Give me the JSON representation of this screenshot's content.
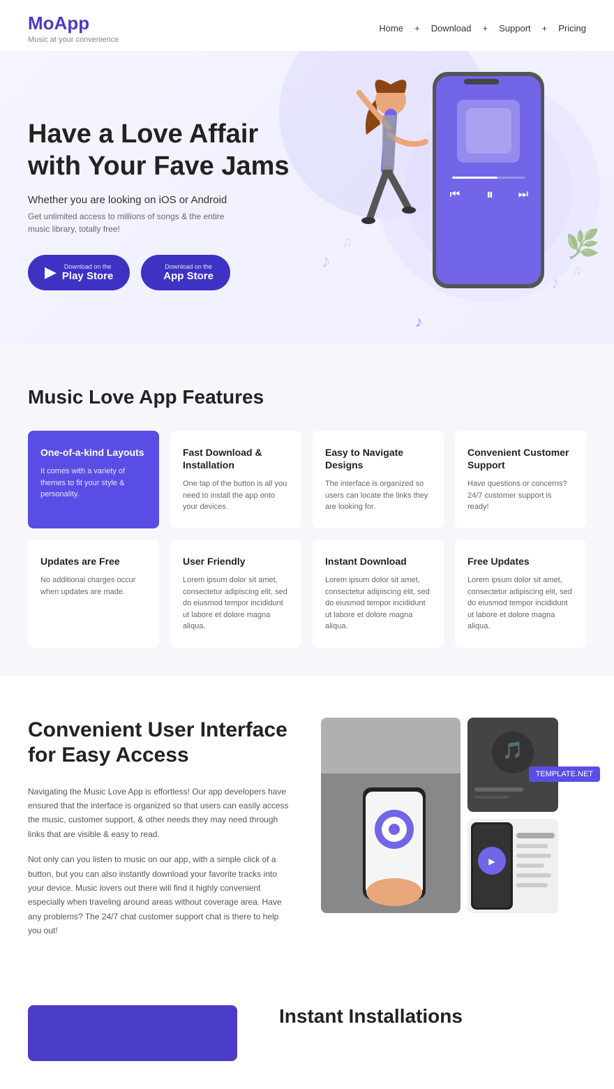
{
  "nav": {
    "logo": "MoApp",
    "tagline": "Music at your convenience",
    "links": [
      "Home",
      "Download",
      "Support",
      "Pricing"
    ],
    "separator": "+"
  },
  "hero": {
    "title_line1": "Have a Love Affair",
    "title_line2": "with Your Fave Jams",
    "subtitle": "Whether you are looking on iOS or Android",
    "desc": "Get unlimited access to millions of songs & the entire\nmusic library, totally free!",
    "btn1_top": "Download on the",
    "btn1_main": "Play Store",
    "btn2_top": "Download on the",
    "btn2_main": "App Store"
  },
  "features": {
    "section_title": "Music Love App Features",
    "row1": [
      {
        "title": "One-of-a-kind Layouts",
        "desc": "It comes with a variety of themes to fit your style & personality.",
        "highlight": true
      },
      {
        "title": "Fast Download & Installation",
        "desc": "One tap of the button is all you need to install the app onto your devices.",
        "highlight": false
      },
      {
        "title": "Easy to Navigate Designs",
        "desc": "The interface is organized so users can locate the links they are looking for.",
        "highlight": false
      },
      {
        "title": "Convenient Customer Support",
        "desc": "Have questions or concerns? 24/7 customer support is ready!",
        "highlight": false
      }
    ],
    "row2": [
      {
        "title": "Updates are Free",
        "desc": "No additional charges occur when updates are made.",
        "highlight": false
      },
      {
        "title": "User Friendly",
        "desc": "Lorem ipsum dolor sit amet, consectetur adipiscing elit, sed do eiusmod tempor incididunt ut labore et dolore magna aliqua.",
        "highlight": false
      },
      {
        "title": "Instant Download",
        "desc": "Lorem ipsum dolor sit amet, consectetur adipiscing elit, sed do eiusmod tempor incididunt ut labore et dolore magna aliqua.",
        "highlight": false
      },
      {
        "title": "Free Updates",
        "desc": "Lorem ipsum dolor sit amet, consectetur adipiscing elit, sed do eiusmod tempor incididunt ut labore et dolore magna aliqua.",
        "highlight": false
      }
    ]
  },
  "ui_section": {
    "title_line1": "Convenient User Interface",
    "title_line2": "for Easy Access",
    "para1": "Navigating the Music Love App is effortless!  Our app developers have ensured that the interface is organized so that users can easily access the music, customer support, & other needs they may need through links that are visible & easy to read.",
    "para2": "Not only can you listen to music on our app, with a simple click of a button, but you can also instantly download your favorite tracks into your device. Music lovers out there will find it highly convenient especially when traveling around areas without coverage area.  Have any problems?  The 24/7 chat customer support chat is there to help you out!"
  },
  "bottom": {
    "title": "Instant Installations"
  },
  "template_badge": "TEMPLATE.NET"
}
